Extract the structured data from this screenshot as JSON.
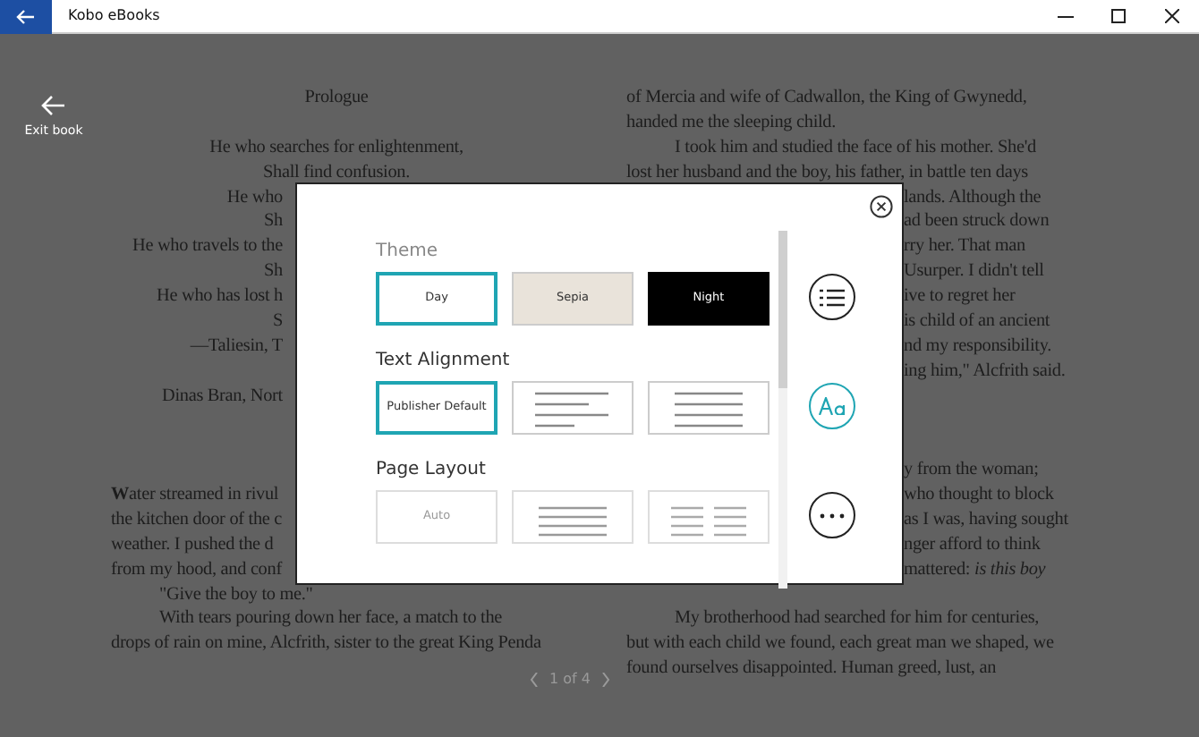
{
  "window": {
    "title": "Kobo eBooks"
  },
  "exit_button": {
    "label": "Exit book"
  },
  "book": {
    "left_column": [
      {
        "kind": "center",
        "text": "Prologue"
      },
      {
        "kind": "blank"
      },
      {
        "kind": "center",
        "text": "He who searches for enlightenment,"
      },
      {
        "kind": "center",
        "text": "Shall find confusion."
      },
      {
        "kind": "clipped",
        "text": "He who"
      },
      {
        "kind": "clipped",
        "text": "Sh"
      },
      {
        "kind": "clipped",
        "text": "He who travels to the"
      },
      {
        "kind": "clipped",
        "text": "Sh"
      },
      {
        "kind": "clipped",
        "text": "He who has lost h"
      },
      {
        "kind": "clipped",
        "text": "S"
      },
      {
        "kind": "clipped",
        "text": "—Taliesin, T"
      },
      {
        "kind": "blank"
      },
      {
        "kind": "clipped",
        "text": "Dinas Bran, Nort"
      },
      {
        "kind": "blank"
      },
      {
        "kind": "blank"
      },
      {
        "kind": "blank"
      },
      {
        "kind": "left",
        "text": "**W**ater streamed in rivul"
      },
      {
        "kind": "left",
        "text": "the kitchen door of the c"
      },
      {
        "kind": "left",
        "text": "weather. I pushed the d"
      },
      {
        "kind": "left",
        "text": "from my hood, and conf"
      },
      {
        "kind": "indent",
        "text": "\"Give the boy to me.\""
      },
      {
        "kind": "indent",
        "text": "With tears pouring down her face, a match to the"
      },
      {
        "kind": "left",
        "text": "drops of rain on mine, Alcfrith, sister to the great King Penda"
      }
    ],
    "right_column": [
      {
        "kind": "left",
        "text": "of Mercia and wife of Cadwallon, the King of Gwynedd,"
      },
      {
        "kind": "left",
        "text": "handed me the sleeping child."
      },
      {
        "kind": "indent",
        "text": "I took him and studied the face of his mother. She'd"
      },
      {
        "kind": "left",
        "text": "lost her husband and the boy, his father, in battle ten days"
      },
      {
        "kind": "clipped",
        "text": "lands. Although the"
      },
      {
        "kind": "clipped",
        "text": "ad been struck down"
      },
      {
        "kind": "clipped",
        "text": "rry her. That man"
      },
      {
        "kind": "clipped",
        "text": "Usurper. I didn't tell"
      },
      {
        "kind": "clipped",
        "text": "ive to regret her"
      },
      {
        "kind": "clipped",
        "text": "is child of an ancient"
      },
      {
        "kind": "clipped",
        "text": "nd my responsibility."
      },
      {
        "kind": "clipped",
        "text": "ing him,\" Alcfrith said."
      },
      {
        "kind": "blank"
      },
      {
        "kind": "blank"
      },
      {
        "kind": "blank"
      },
      {
        "kind": "clipped",
        "text": "y from the woman;"
      },
      {
        "kind": "clipped",
        "text": "who thought to block"
      },
      {
        "kind": "clipped",
        "text": "as I was, having sought"
      },
      {
        "kind": "clipped",
        "text": "nger afford to think"
      },
      {
        "kind": "clipped",
        "text": "mattered: *is this boy*"
      },
      {
        "kind": "blank"
      },
      {
        "kind": "indent",
        "text": "My brotherhood had searched for him for centuries,"
      },
      {
        "kind": "left",
        "text": "but with each child we found, each great man we shaped, we"
      },
      {
        "kind": "left",
        "text": "found ourselves disappointed. Human greed, lust, an"
      }
    ],
    "page_indicator": "1 of 4"
  },
  "settings_panel": {
    "sections": [
      {
        "title": "Theme",
        "options": [
          {
            "kind": "day",
            "label": "Day",
            "selected": true
          },
          {
            "kind": "sepia",
            "label": "Sepia",
            "selected": false
          },
          {
            "kind": "night",
            "label": "Night",
            "selected": false
          }
        ]
      },
      {
        "title": "Text Alignment",
        "options": [
          {
            "kind": "text",
            "label": "Publisher Default",
            "selected": true
          },
          {
            "kind": "ragged",
            "selected": false
          },
          {
            "kind": "justified",
            "selected": false
          }
        ]
      },
      {
        "title": "Page Layout",
        "options": [
          {
            "kind": "text",
            "label": "Auto",
            "selected": false,
            "disabled": true
          },
          {
            "kind": "one-column",
            "selected": false,
            "disabled": true
          },
          {
            "kind": "two-column",
            "selected": false,
            "disabled": true
          }
        ]
      }
    ],
    "side_buttons": [
      {
        "kind": "contents",
        "selected": false
      },
      {
        "kind": "font",
        "selected": true
      },
      {
        "kind": "more",
        "selected": false
      }
    ]
  }
}
